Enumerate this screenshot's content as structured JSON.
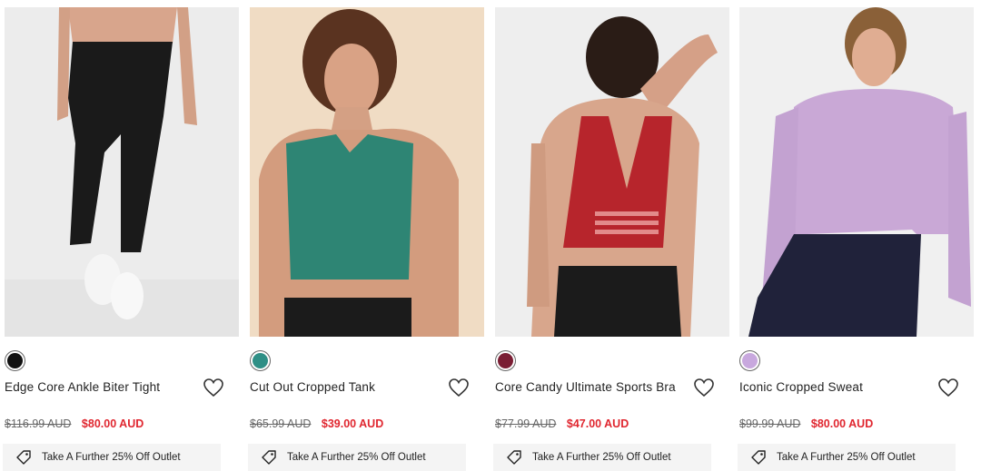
{
  "products": [
    {
      "name": "Edge Core Ankle Biter Tight",
      "swatch_color": "#111111",
      "was_price": "$116.99 AUD",
      "now_price": "$80.00 AUD",
      "promo": "Take A Further 25% Off Outlet",
      "image_subject": "black ankle biter leggings"
    },
    {
      "name": "Cut Out Cropped Tank",
      "swatch_color": "#2f8f86",
      "was_price": "$65.99 AUD",
      "now_price": "$39.00 AUD",
      "promo": "Take A Further 25% Off Outlet",
      "image_subject": "green cropped tank"
    },
    {
      "name": "Core Candy Ultimate Sports Bra",
      "swatch_color": "#7a1e34",
      "was_price": "$77.99 AUD",
      "now_price": "$47.00 AUD",
      "promo": "Take A Further 25% Off Outlet",
      "image_subject": "red sports bra back view"
    },
    {
      "name": "Iconic Cropped Sweat",
      "swatch_color": "#c8a8de",
      "was_price": "$99.99 AUD",
      "now_price": "$80.00 AUD",
      "promo": "Take A Further 25% Off Outlet",
      "image_subject": "lilac cropped sweatshirt"
    }
  ],
  "colors": {
    "sale_red": "#e0262f",
    "promo_bg": "#f4f4f4"
  },
  "icons": {
    "wishlist": "heart-icon",
    "promo": "tag-icon"
  }
}
